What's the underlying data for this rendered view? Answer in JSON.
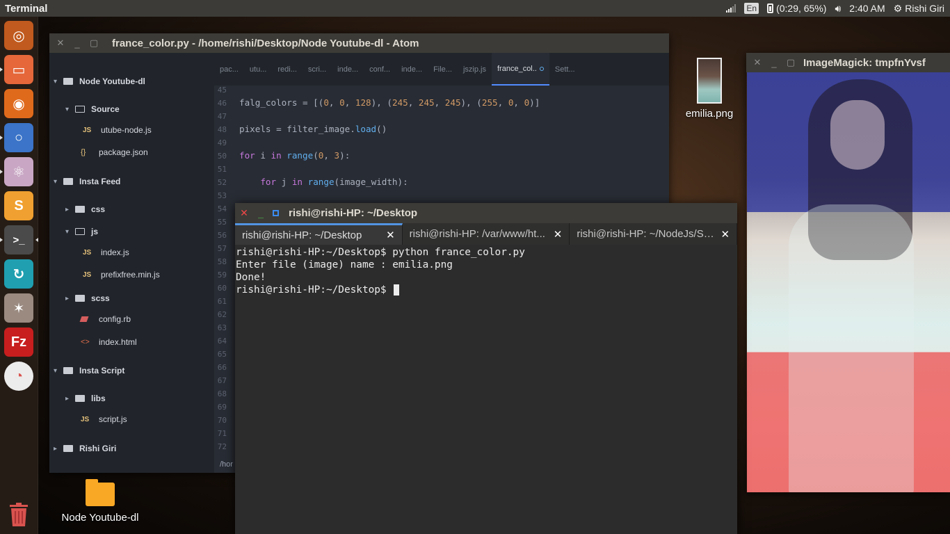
{
  "top_panel": {
    "app_name": "Terminal",
    "keyboard_layout": "En",
    "battery": "(0:29, 65%)",
    "clock": "2:40 AM",
    "user": "Rishi Giri"
  },
  "launcher": {
    "items": [
      {
        "name": "dash",
        "glyph": "◎",
        "color": "#c05a1e",
        "running": false
      },
      {
        "name": "files",
        "glyph": "▭",
        "color": "#e5673a",
        "running": true
      },
      {
        "name": "firefox",
        "glyph": "◉",
        "color": "#e06a1c",
        "running": false
      },
      {
        "name": "chromium",
        "glyph": "○",
        "color": "#3b74c8",
        "running": true
      },
      {
        "name": "atom",
        "glyph": "⚛",
        "color": "#c9a7c4",
        "running": true
      },
      {
        "name": "sublime",
        "glyph": "S",
        "color": "#f0a030",
        "running": false
      },
      {
        "name": "terminal",
        "glyph": ">_",
        "color": "#4a4a4a",
        "running": true,
        "active": true
      },
      {
        "name": "update",
        "glyph": "↻",
        "color": "#1f9fb0",
        "running": false
      },
      {
        "name": "wizard",
        "glyph": "✶",
        "color": "#9a8a80",
        "running": false
      },
      {
        "name": "filezilla",
        "glyph": "Fz",
        "color": "#c81e1e",
        "running": false
      },
      {
        "name": "pie",
        "glyph": "◔",
        "color": "#ececec",
        "running": false
      }
    ]
  },
  "atom": {
    "title": "france_color.py - /home/rishi/Desktop/Node Youtube-dl - Atom",
    "tree": [
      {
        "label": "Node Youtube-dl",
        "type": "folder",
        "open": true,
        "depth": 0
      },
      {
        "label": "Source",
        "type": "folder",
        "open": true,
        "depth": 1
      },
      {
        "label": "utube-node.js",
        "type": "js",
        "depth": 2
      },
      {
        "label": "package.json",
        "type": "json",
        "depth": 1
      },
      {
        "label": "Insta Feed",
        "type": "folder",
        "open": true,
        "depth": 0
      },
      {
        "label": "css",
        "type": "folder",
        "open": false,
        "depth": 1
      },
      {
        "label": "js",
        "type": "folder",
        "open": true,
        "depth": 1
      },
      {
        "label": "index.js",
        "type": "js",
        "depth": 2
      },
      {
        "label": "prefixfree.min.js",
        "type": "js",
        "depth": 2
      },
      {
        "label": "scss",
        "type": "folder",
        "open": false,
        "depth": 1
      },
      {
        "label": "config.rb",
        "type": "rb",
        "depth": 1
      },
      {
        "label": "index.html",
        "type": "html",
        "depth": 1
      },
      {
        "label": "Insta Script",
        "type": "folder",
        "open": true,
        "depth": 0
      },
      {
        "label": "libs",
        "type": "folder",
        "open": false,
        "depth": 1
      },
      {
        "label": "script.js",
        "type": "js",
        "depth": 1
      },
      {
        "label": "Rishi Giri",
        "type": "folder",
        "open": false,
        "depth": 0
      }
    ],
    "tabs": [
      "pac...",
      "utu...",
      "redi...",
      "scri...",
      "inde...",
      "conf...",
      "inde...",
      "File...",
      "jszip.js",
      "france_col..",
      "Sett..."
    ],
    "active_tab": 9,
    "line_numbers": [
      "45",
      "46",
      "47",
      "48",
      "49",
      "50",
      "51",
      "52",
      "53",
      "54",
      "55",
      "56",
      "57",
      "58",
      "59",
      "60",
      "61",
      "62",
      "63",
      "64",
      "65",
      "66",
      "67",
      "68",
      "69",
      "70",
      "71",
      "72"
    ],
    "code_lines": [
      {
        "line": "46",
        "text": "falg_colors = [(0, 0, 128), (245, 245, 245), (255, 0, 0)]"
      },
      {
        "line": "48",
        "text": "pixels = filter_image.load()"
      },
      {
        "line": "50",
        "text": "for i in range(0, 3):"
      },
      {
        "line": "52",
        "text": "    for j in range(image_width):"
      }
    ],
    "status": "/hor"
  },
  "desktop": {
    "file_icon_label": "emilia.png",
    "folder_icon_label": "Node Youtube-dl"
  },
  "imagemagick": {
    "title": "ImageMagick: tmpfnYvsf"
  },
  "terminal": {
    "title": "rishi@rishi-HP: ~/Desktop",
    "tabs": [
      {
        "label": "rishi@rishi-HP: ~/Desktop",
        "active": true
      },
      {
        "label": "rishi@rishi-HP: /var/www/ht...",
        "active": false
      },
      {
        "label": "rishi@rishi-HP: ~/NodeJs/Se...",
        "active": false
      }
    ],
    "lines": [
      "rishi@rishi-HP:~/Desktop$ python france_color.py",
      "Enter file (image) name : emilia.png",
      "Done!",
      "rishi@rishi-HP:~/Desktop$ "
    ]
  },
  "colors": {
    "flag_blue": "#4048aa",
    "flag_white": "#f5f5f5",
    "flag_red": "#f06464",
    "panel": "#3c3b37",
    "atom_bg": "#282c34",
    "terminal_bg": "#2c2c2c",
    "tab_accent": "#5294e2"
  }
}
